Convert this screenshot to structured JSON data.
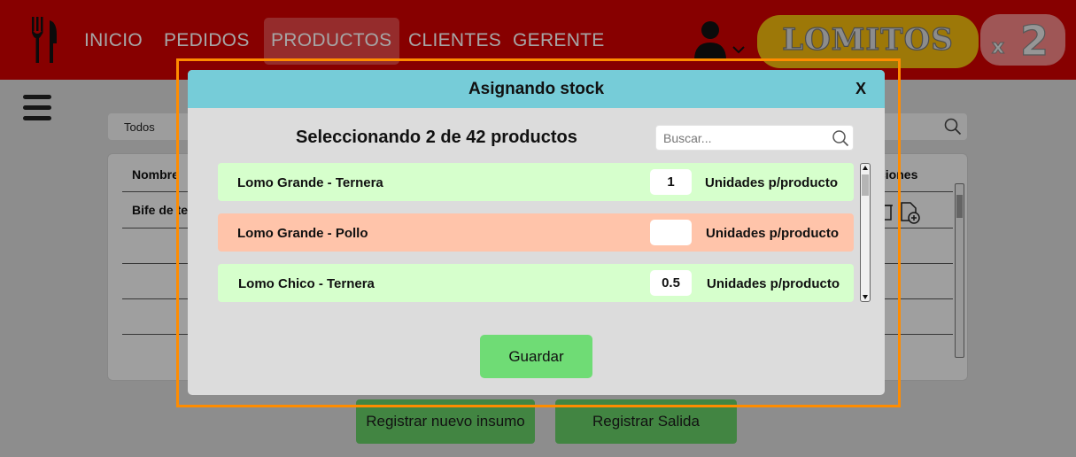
{
  "nav": {
    "items": [
      {
        "label": "INICIO",
        "active": false
      },
      {
        "label": "PEDIDOS",
        "active": false
      },
      {
        "label": "PRODUCTOS",
        "active": true
      },
      {
        "label": "CLIENTES",
        "active": false
      },
      {
        "label": "GERENTE",
        "active": false
      }
    ],
    "logo": {
      "word": "LOMITOS",
      "badge": "x2"
    },
    "icons": {
      "brand": "fork-knife-icon",
      "user": "user-icon",
      "user_menu": "chevron-down-icon"
    }
  },
  "background_page": {
    "filter_label": "Todos",
    "table": {
      "headers": [
        "Nombre",
        "ciones"
      ],
      "rows": [
        {
          "name": "Bife de te"
        }
      ]
    },
    "buttons": {
      "new_supply": "Registrar nuevo insumo",
      "register_exit": "Registrar Salida"
    }
  },
  "modal": {
    "title": "Asignando stock",
    "close_label": "X",
    "selection_text": "Seleccionando 2 de 42 productos",
    "search": {
      "placeholder": "Buscar...",
      "value": ""
    },
    "unit_label": "Unidades p/producto",
    "products": [
      {
        "name": "Lomo Grande - Ternera",
        "quantity": "1",
        "status": "valid"
      },
      {
        "name": "Lomo Grande - Pollo",
        "quantity": "",
        "status": "missing"
      },
      {
        "name": "Lomo Chico - Ternera",
        "quantity": "0.5",
        "status": "valid"
      }
    ],
    "save_label": "Guardar"
  },
  "colors": {
    "topbar": "#d00000",
    "modal_header": "#76ccd8",
    "row_valid": "#d6ffcc",
    "row_missing": "#ffc4aa",
    "save_button": "#6fdc75",
    "highlight_frame": "#ff8c00"
  }
}
